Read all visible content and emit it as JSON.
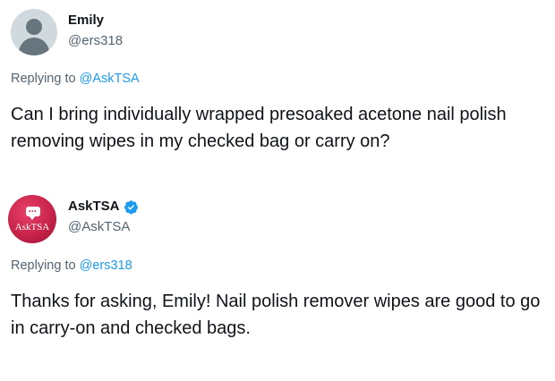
{
  "tweets": [
    {
      "name": "Emily",
      "handle": "@ers318",
      "replying_prefix": "Replying to ",
      "replying_to": "@AskTSA",
      "text": "Can I bring individually wrapped presoaked acetone nail polish removing wipes in my checked bag or carry on?",
      "avatar": "default-avatar"
    },
    {
      "name": "AskTSA",
      "handle": "@AskTSA",
      "verified": true,
      "avatar_brand_text": "AskTSA",
      "replying_prefix": "Replying to ",
      "replying_to": "@ers318",
      "text": "Thanks for asking, Emily! Nail polish remover wipes are good to go in carry-on and checked bags."
    }
  ],
  "colors": {
    "text": "#0f1419",
    "secondary": "#536471",
    "link": "#1d9bf0",
    "tsa_brand": "#c8234a",
    "verified": "#1d9bf0"
  }
}
